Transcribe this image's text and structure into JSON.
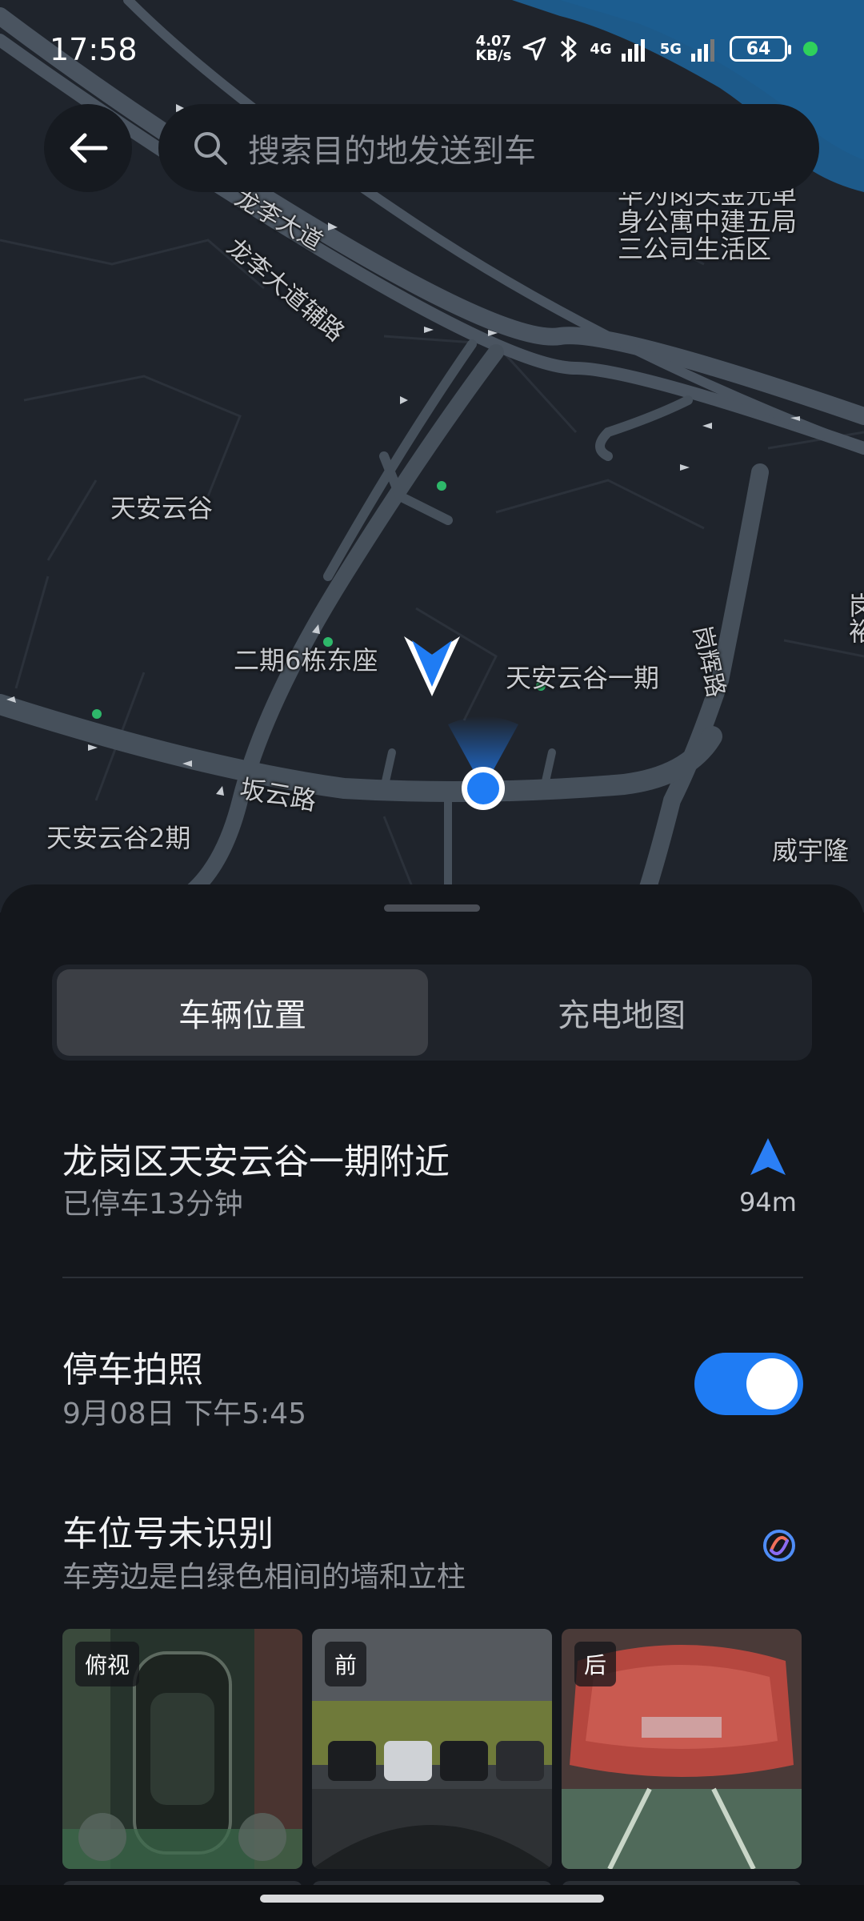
{
  "status_bar": {
    "time": "17:58",
    "net_speed_value": "4.07",
    "net_speed_unit": "KB/s",
    "sig1_label": "4G",
    "sig2_label": "5G",
    "battery": "64"
  },
  "search": {
    "placeholder": "搜索目的地发送到车"
  },
  "map": {
    "labels": {
      "road_longli": "龙李大道",
      "road_longli_aux": "龙李大道辅路",
      "poi_huawei": "华为岗头金元单",
      "poi_huawei2": "身公寓中建五局",
      "poi_huawei3": "三公司生活区",
      "poi_tianan": "天安云谷",
      "poi_phase2_b6": "二期6栋东座",
      "poi_tianan_phase1": "天安云谷一期",
      "road_gamhui": "岗辉路",
      "road_banyun": "坂云路",
      "poi_tianan_phase2": "天安云谷2期",
      "poi_weiyu": "威宇隆",
      "poi_edge": "岗裕"
    }
  },
  "tabs": {
    "vehicle_location": "车辆位置",
    "charging_map": "充电地图"
  },
  "location": {
    "address": "龙岗区天安云谷一期附近",
    "parked_duration": "已停车13分钟",
    "distance": "94m"
  },
  "parking_photo": {
    "title": "停车拍照",
    "timestamp": "9月08日 下午5:45",
    "enabled": true
  },
  "spot": {
    "title": "车位号未识别",
    "description": "车旁边是白绿色相间的墙和立柱"
  },
  "photos": {
    "top_view": "俯视",
    "front": "前",
    "rear": "后"
  },
  "colors": {
    "accent": "#1f7cf4",
    "sheet_bg": "#14171c",
    "map_bg": "#1f242c"
  }
}
